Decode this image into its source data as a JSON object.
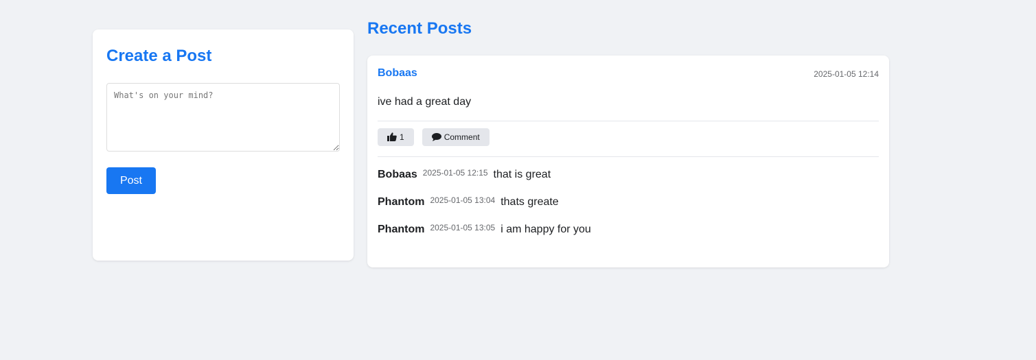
{
  "create": {
    "title": "Create a Post",
    "placeholder": "What's on your mind?",
    "value": "",
    "post_label": "Post"
  },
  "feed": {
    "title": "Recent Posts",
    "posts": [
      {
        "author": "Bobaas",
        "time": "2025-01-05 12:14",
        "content": "ive had a great day",
        "like_count": "1",
        "like_icon": "thumbs-up-icon",
        "comment_icon": "speech-bubble-icon",
        "comment_label": "Comment",
        "comments": [
          {
            "author": "Bobaas",
            "time": "2025-01-05 12:15",
            "text": "that is great"
          },
          {
            "author": "Phantom",
            "time": "2025-01-05 13:04",
            "text": "thats greate"
          },
          {
            "author": "Phantom",
            "time": "2025-01-05 13:05",
            "text": "i am happy for you"
          }
        ]
      }
    ]
  },
  "colors": {
    "accent": "#1877f2",
    "background": "#f0f2f5",
    "card": "#ffffff",
    "button_secondary": "#e4e6eb",
    "muted_text": "#65676b"
  }
}
